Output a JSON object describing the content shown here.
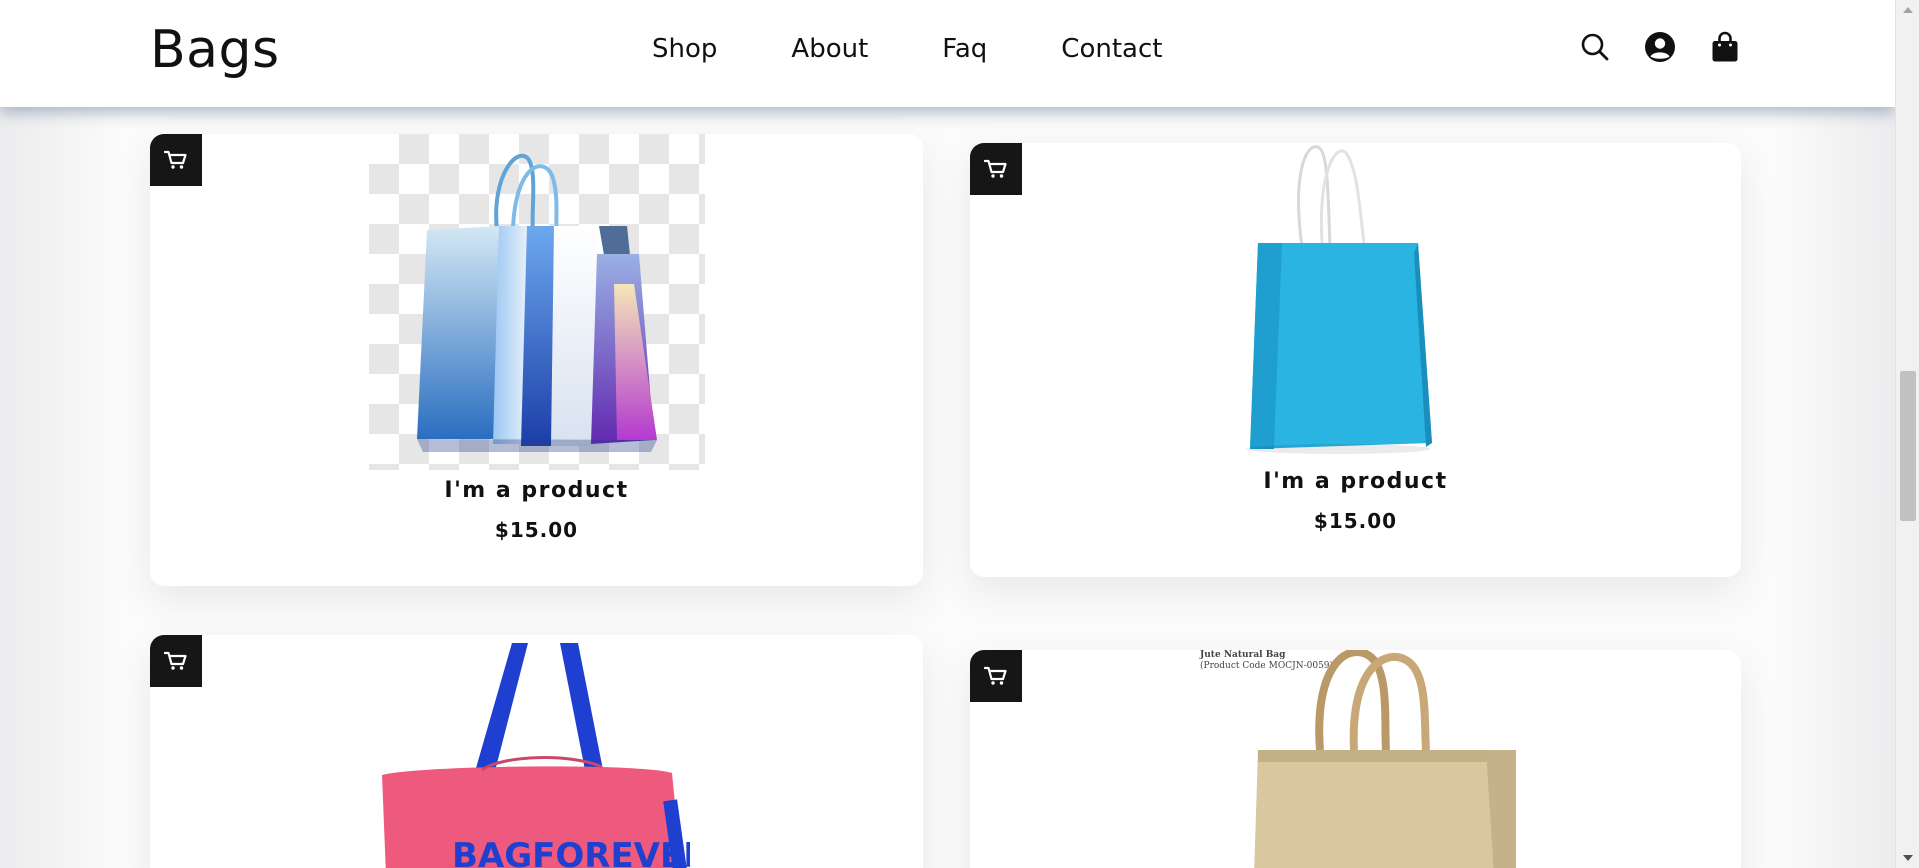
{
  "header": {
    "logo": "Bags",
    "nav": [
      "Shop",
      "About",
      "Faq",
      "Contact"
    ],
    "icons": [
      "search-icon",
      "account-icon",
      "shopping-bag-icon"
    ]
  },
  "products": [
    {
      "name": "I'm a product",
      "price": "$15.00",
      "image": "multicolor-shopping-bags"
    },
    {
      "name": "I'm a product",
      "price": "$15.00",
      "image": "blue-paper-bag"
    },
    {
      "name": "",
      "price": "",
      "image": "pink-tote-bag",
      "brand_text": "BAGFOREVER"
    },
    {
      "name": "",
      "price": "",
      "image": "jute-natural-bag",
      "caption": "Jute Natural Bag",
      "code": "(Product Code MOCJN-0059)"
    }
  ],
  "colors": {
    "header_shadow": "#5a6e8c",
    "cart_button": "#161616",
    "blue_bag": "#2ab4e2",
    "pink_bag": "#ee5a7d",
    "strap_blue": "#1f3fd0",
    "jute": "#d9c7a0"
  }
}
